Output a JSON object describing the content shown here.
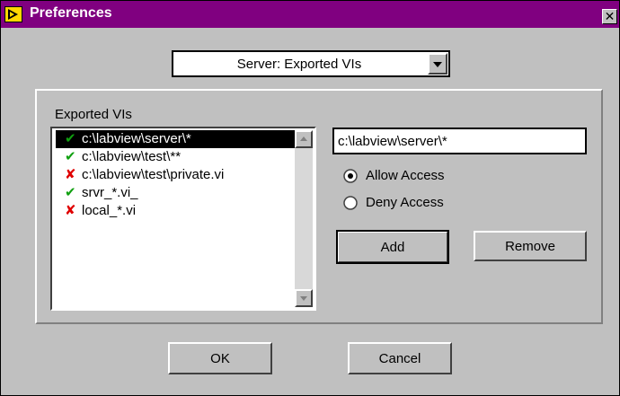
{
  "window": {
    "title": "Preferences",
    "close_glyph": "✕",
    "colors": {
      "titlebar": "#800080",
      "face": "#c0c0c0"
    }
  },
  "category_select": {
    "value": "Server: Exported VIs"
  },
  "exported_vis": {
    "label": "Exported VIs",
    "items": [
      {
        "mark": "✔",
        "status": "allow",
        "text": "c:\\labview\\server\\*",
        "selected": true
      },
      {
        "mark": "✔",
        "status": "allow",
        "text": "c:\\labview\\test\\**",
        "selected": false
      },
      {
        "mark": "✘",
        "status": "deny",
        "text": "c:\\labview\\test\\private.vi",
        "selected": false
      },
      {
        "mark": "✔",
        "status": "allow",
        "text": "srvr_*.vi_",
        "selected": false
      },
      {
        "mark": "✘",
        "status": "deny",
        "text": "local_*.vi",
        "selected": false
      }
    ]
  },
  "path_input": {
    "value": "c:\\labview\\server\\*"
  },
  "access": {
    "allow_label": "Allow Access",
    "deny_label": "Deny Access",
    "selected": "allow"
  },
  "buttons": {
    "add": "Add",
    "remove": "Remove",
    "ok": "OK",
    "cancel": "Cancel"
  }
}
